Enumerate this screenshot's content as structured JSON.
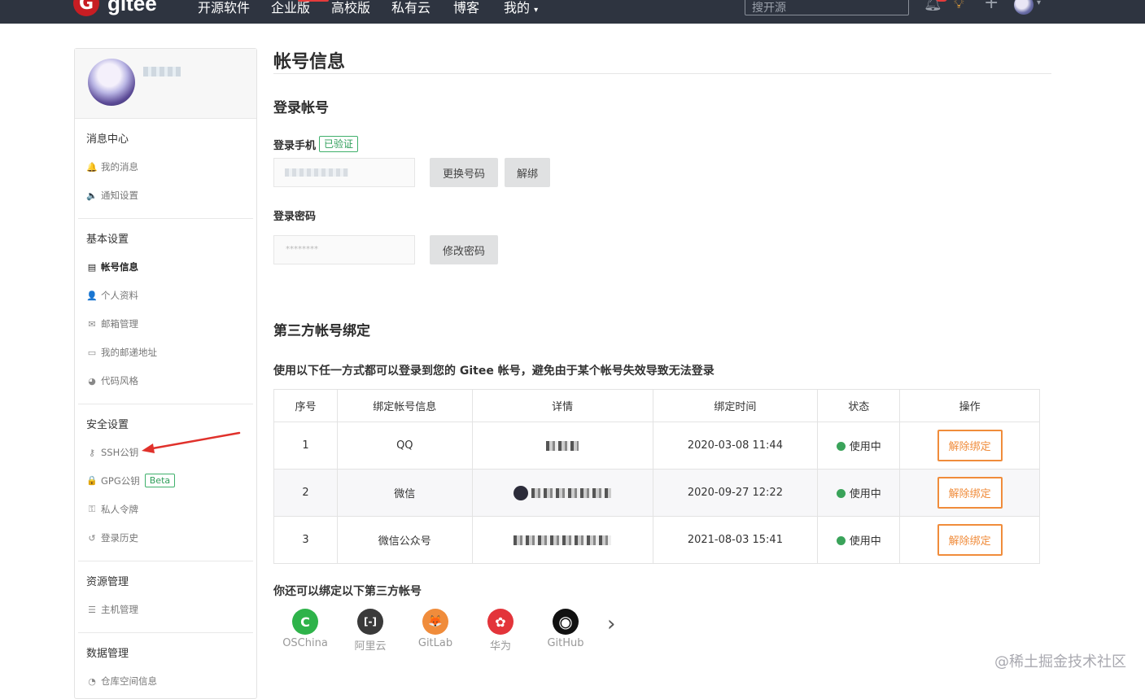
{
  "nav": {
    "logo_letter": "G",
    "logo_text": "gitee",
    "items": [
      "开源软件",
      "企业版",
      "高校版",
      "私有云",
      "博客",
      "我的"
    ],
    "search_placeholder": "搜开源",
    "icons": [
      "bell-icon",
      "lightbulb-icon",
      "plus-icon",
      "user-avatar"
    ]
  },
  "sidebar": {
    "sections": [
      {
        "title": "消息中心",
        "items": [
          {
            "icon": "bell-icon",
            "glyph": "🔔",
            "label": "我的消息"
          },
          {
            "icon": "speaker-icon",
            "glyph": "🔈",
            "label": "通知设置"
          }
        ]
      },
      {
        "title": "基本设置",
        "items": [
          {
            "icon": "id-card-icon",
            "glyph": "▤",
            "label": "帐号信息",
            "active": true
          },
          {
            "icon": "user-icon",
            "glyph": "👤",
            "label": "个人资料"
          },
          {
            "icon": "mail-icon",
            "glyph": "✉",
            "label": "邮箱管理"
          },
          {
            "icon": "address-card-icon",
            "glyph": "▭",
            "label": "我的邮递地址"
          },
          {
            "icon": "palette-icon",
            "glyph": "◕",
            "label": "代码风格"
          }
        ]
      },
      {
        "title": "安全设置",
        "items": [
          {
            "icon": "key-icon",
            "glyph": "⚷",
            "label": "SSH公钥"
          },
          {
            "icon": "lock-icon",
            "glyph": "🔒",
            "label": "GPG公钥",
            "badge": "Beta"
          },
          {
            "icon": "token-icon",
            "glyph": "⚿",
            "label": "私人令牌"
          },
          {
            "icon": "history-icon",
            "glyph": "↺",
            "label": "登录历史"
          }
        ]
      },
      {
        "title": "资源管理",
        "items": [
          {
            "icon": "server-icon",
            "glyph": "☰",
            "label": "主机管理"
          }
        ]
      },
      {
        "title": "数据管理",
        "items": [
          {
            "icon": "pie-icon",
            "glyph": "◔",
            "label": "仓库空间信息"
          }
        ]
      }
    ]
  },
  "main": {
    "page_title": "帐号信息",
    "login_section_title": "登录帐号",
    "phone_label": "登录手机",
    "verified_badge": "已验证",
    "change_number_button": "更换号码",
    "unbind_phone_button": "解绑",
    "password_label": "登录密码",
    "password_masked": "********",
    "change_password_button": "修改密码",
    "third_party_title": "第三方帐号绑定",
    "third_party_desc": "使用以下任一方式都可以登录到您的 Gitee 帐号，避免由于某个帐号失效导致无法登录",
    "table": {
      "headers": [
        "序号",
        "绑定帐号信息",
        "详情",
        "绑定时间",
        "状态",
        "操作"
      ],
      "rows": [
        {
          "index": "1",
          "account": "QQ",
          "time": "2020-03-08 11:44",
          "status": "使用中",
          "action": "解除绑定"
        },
        {
          "index": "2",
          "account": "微信",
          "time": "2020-09-27 12:22",
          "status": "使用中",
          "action": "解除绑定"
        },
        {
          "index": "3",
          "account": "微信公众号",
          "time": "2021-08-03 15:41",
          "status": "使用中",
          "action": "解除绑定"
        }
      ]
    },
    "more_title": "你还可以绑定以下第三方帐号",
    "providers": [
      {
        "name": "OSChina",
        "icon": "oschina-icon",
        "color": "#2eb34a",
        "glyph": "C"
      },
      {
        "name": "阿里云",
        "icon": "aliyun-icon",
        "color": "#3a3a3a",
        "glyph": "[-]"
      },
      {
        "name": "GitLab",
        "icon": "gitlab-icon",
        "color": "#f08c3b",
        "glyph": "🦊"
      },
      {
        "name": "华为",
        "icon": "huawei-icon",
        "color": "#e3343a",
        "glyph": "✿"
      },
      {
        "name": "GitHub",
        "icon": "github-icon",
        "color": "#111111",
        "glyph": "◉"
      }
    ]
  },
  "watermark": "@稀土掘金技术社区",
  "colors": {
    "nav_bg": "#2e3440",
    "accent_orange": "#f08c3b",
    "verified_green": "#2f9e5a",
    "status_green": "#3aa35a"
  }
}
